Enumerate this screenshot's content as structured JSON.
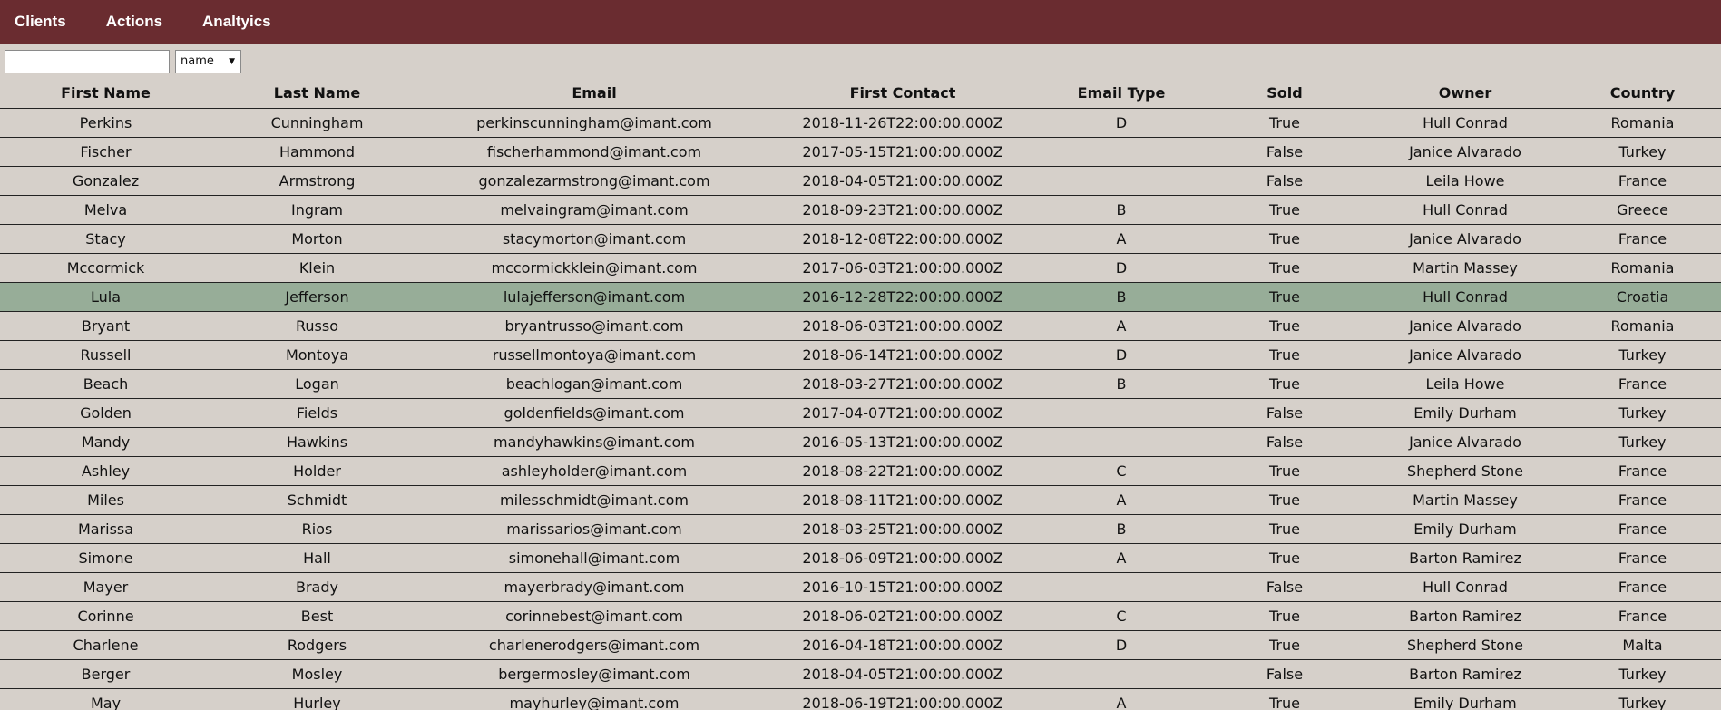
{
  "nav": {
    "items": [
      "Clients",
      "Actions",
      "Analtyics"
    ]
  },
  "controls": {
    "search_value": "",
    "select_value": "name"
  },
  "table": {
    "columns": [
      "First Name",
      "Last Name",
      "Email",
      "First Contact",
      "Email Type",
      "Sold",
      "Owner",
      "Country"
    ],
    "selected_row": 6,
    "rows": [
      [
        "Perkins",
        "Cunningham",
        "perkinscunningham@imant.com",
        "2018-11-26T22:00:00.000Z",
        "D",
        "True",
        "Hull Conrad",
        "Romania"
      ],
      [
        "Fischer",
        "Hammond",
        "fischerhammond@imant.com",
        "2017-05-15T21:00:00.000Z",
        "",
        "False",
        "Janice Alvarado",
        "Turkey"
      ],
      [
        "Gonzalez",
        "Armstrong",
        "gonzalezarmstrong@imant.com",
        "2018-04-05T21:00:00.000Z",
        "",
        "False",
        "Leila Howe",
        "France"
      ],
      [
        "Melva",
        "Ingram",
        "melvaingram@imant.com",
        "2018-09-23T21:00:00.000Z",
        "B",
        "True",
        "Hull Conrad",
        "Greece"
      ],
      [
        "Stacy",
        "Morton",
        "stacymorton@imant.com",
        "2018-12-08T22:00:00.000Z",
        "A",
        "True",
        "Janice Alvarado",
        "France"
      ],
      [
        "Mccormick",
        "Klein",
        "mccormickklein@imant.com",
        "2017-06-03T21:00:00.000Z",
        "D",
        "True",
        "Martin Massey",
        "Romania"
      ],
      [
        "Lula",
        "Jefferson",
        "lulajefferson@imant.com",
        "2016-12-28T22:00:00.000Z",
        "B",
        "True",
        "Hull Conrad",
        "Croatia"
      ],
      [
        "Bryant",
        "Russo",
        "bryantrusso@imant.com",
        "2018-06-03T21:00:00.000Z",
        "A",
        "True",
        "Janice Alvarado",
        "Romania"
      ],
      [
        "Russell",
        "Montoya",
        "russellmontoya@imant.com",
        "2018-06-14T21:00:00.000Z",
        "D",
        "True",
        "Janice Alvarado",
        "Turkey"
      ],
      [
        "Beach",
        "Logan",
        "beachlogan@imant.com",
        "2018-03-27T21:00:00.000Z",
        "B",
        "True",
        "Leila Howe",
        "France"
      ],
      [
        "Golden",
        "Fields",
        "goldenfields@imant.com",
        "2017-04-07T21:00:00.000Z",
        "",
        "False",
        "Emily Durham",
        "Turkey"
      ],
      [
        "Mandy",
        "Hawkins",
        "mandyhawkins@imant.com",
        "2016-05-13T21:00:00.000Z",
        "",
        "False",
        "Janice Alvarado",
        "Turkey"
      ],
      [
        "Ashley",
        "Holder",
        "ashleyholder@imant.com",
        "2018-08-22T21:00:00.000Z",
        "C",
        "True",
        "Shepherd Stone",
        "France"
      ],
      [
        "Miles",
        "Schmidt",
        "milesschmidt@imant.com",
        "2018-08-11T21:00:00.000Z",
        "A",
        "True",
        "Martin Massey",
        "France"
      ],
      [
        "Marissa",
        "Rios",
        "marissarios@imant.com",
        "2018-03-25T21:00:00.000Z",
        "B",
        "True",
        "Emily Durham",
        "France"
      ],
      [
        "Simone",
        "Hall",
        "simonehall@imant.com",
        "2018-06-09T21:00:00.000Z",
        "A",
        "True",
        "Barton Ramirez",
        "France"
      ],
      [
        "Mayer",
        "Brady",
        "mayerbrady@imant.com",
        "2016-10-15T21:00:00.000Z",
        "",
        "False",
        "Hull Conrad",
        "France"
      ],
      [
        "Corinne",
        "Best",
        "corinnebest@imant.com",
        "2018-06-02T21:00:00.000Z",
        "C",
        "True",
        "Barton Ramirez",
        "France"
      ],
      [
        "Charlene",
        "Rodgers",
        "charlenerodgers@imant.com",
        "2016-04-18T21:00:00.000Z",
        "D",
        "True",
        "Shepherd Stone",
        "Malta"
      ],
      [
        "Berger",
        "Mosley",
        "bergermosley@imant.com",
        "2018-04-05T21:00:00.000Z",
        "",
        "False",
        "Barton Ramirez",
        "Turkey"
      ],
      [
        "May",
        "Hurley",
        "mayhurley@imant.com",
        "2018-06-19T21:00:00.000Z",
        "A",
        "True",
        "Emily Durham",
        "Turkey"
      ]
    ]
  }
}
